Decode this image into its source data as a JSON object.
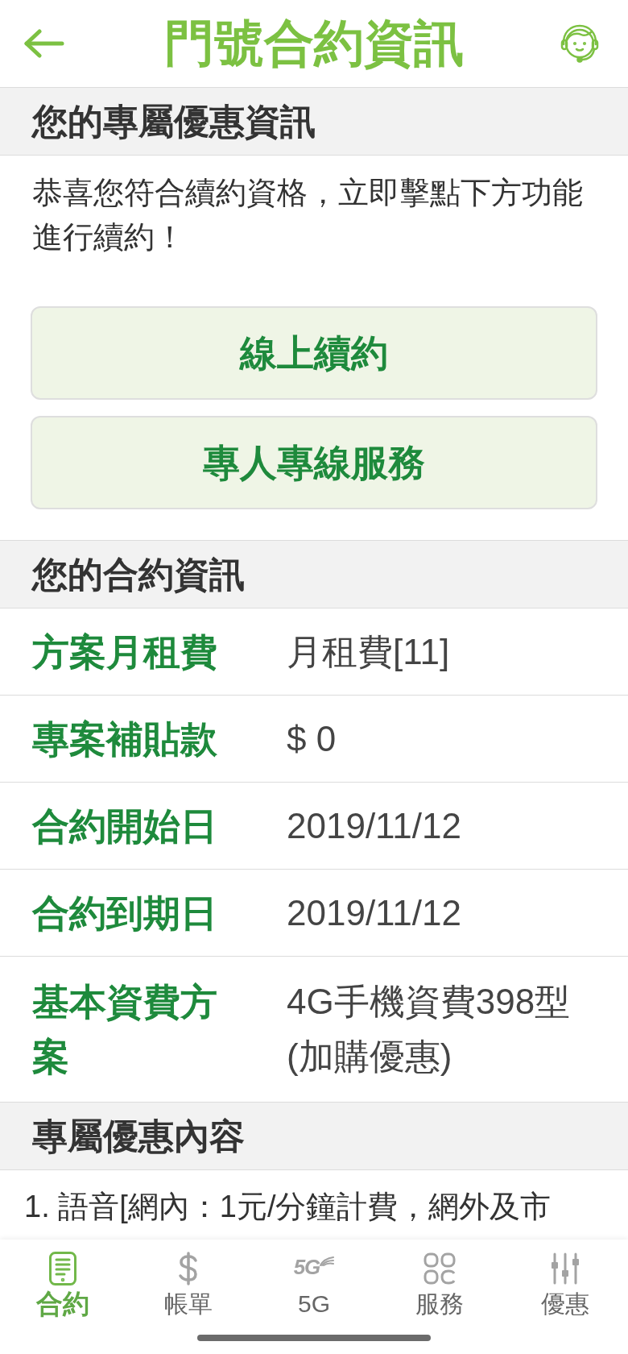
{
  "header": {
    "title": "門號合約資訊"
  },
  "offer_section": {
    "heading": "您的專屬優惠資訊",
    "message": "恭喜您符合續約資格，立即擊點下方功能進行續約！",
    "buttons": [
      "線上續約",
      "專人專線服務"
    ]
  },
  "contract_section": {
    "heading": "您的合約資訊",
    "rows": [
      {
        "label": "方案月租費",
        "value": "月租費[11]"
      },
      {
        "label": "專案補貼款",
        "value": "$ 0"
      },
      {
        "label": "合約開始日",
        "value": "2019/11/12"
      },
      {
        "label": "合約到期日",
        "value": "2019/11/12"
      },
      {
        "label": "基本資費方案",
        "value": "4G手機資費398型(加購優惠)"
      }
    ]
  },
  "benefits_section": {
    "heading": "專屬優惠內容",
    "items": [
      "1. 語音[網內：1元/分鐘計費，網外及市"
    ]
  },
  "bottom_nav": [
    {
      "kind": "contract",
      "label": "合約",
      "selected": true
    },
    {
      "kind": "bill",
      "label": "帳單",
      "selected": false
    },
    {
      "kind": "network",
      "logo_text": "5G",
      "label": "5G",
      "selected": false
    },
    {
      "kind": "services",
      "label": "服務",
      "selected": false
    },
    {
      "kind": "offers",
      "label": "優惠",
      "selected": false
    }
  ]
}
